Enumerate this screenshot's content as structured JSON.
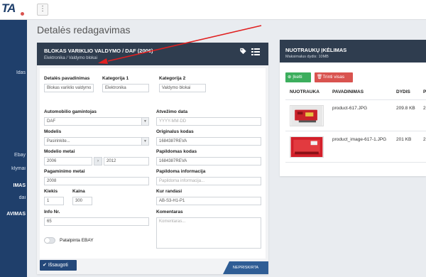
{
  "app": {
    "logo_text": "TA"
  },
  "sidebar": {
    "items": [
      {
        "label": "ldas"
      },
      {
        "label": "Ebay"
      },
      {
        "label": "klymai"
      },
      {
        "label": "IMAS"
      },
      {
        "label": "dai"
      },
      {
        "label": "AVIMAS"
      }
    ]
  },
  "page": {
    "title": "Detalės redagavimas"
  },
  "part_panel": {
    "title": "BLOKAS VARIKLIO VALDYMO / DAF (2006)",
    "subtitle": "Elektronika / Valdymo blokai",
    "fields": {
      "name": {
        "label": "Detalės pavadinimas",
        "value": "Blokas variklio valdymo"
      },
      "category1": {
        "label": "Kategorija 1",
        "value": "Elektronika"
      },
      "category2": {
        "label": "Kategorija 2",
        "value": "Valdymo blokai"
      },
      "manufacturer": {
        "label": "Automobilio gamintojas",
        "value": "DAF"
      },
      "arrival_date": {
        "label": "Atvežimo data",
        "placeholder": "YYYY-MM-DD"
      },
      "model": {
        "label": "Modelis",
        "value": "Pasirinkite..."
      },
      "original_code": {
        "label": "Originalus kodas",
        "value": "1684387REVA"
      },
      "model_years": {
        "label": "Modelio metai",
        "from": "2006",
        "to": "2012"
      },
      "extra_code": {
        "label": "Papildomas kodas",
        "value": "1684387REVA"
      },
      "production_year": {
        "label": "Pagaminimo metai",
        "value": "2008"
      },
      "extra_info": {
        "label": "Papildoma informacija",
        "placeholder": "Papildoma informacija..."
      },
      "quantity": {
        "label": "Kiekis",
        "value": "1"
      },
      "price": {
        "label": "Kaina",
        "value": "300"
      },
      "location": {
        "label": "Kur randasi",
        "value": "AB-S3-H1-P1"
      },
      "info_no": {
        "label": "Info Nr.",
        "value": "65"
      },
      "comments": {
        "label": "Komentaras",
        "placeholder": "Komentaras..."
      },
      "ebay": {
        "label": "Patalpinta EBAY"
      }
    },
    "save_label": "Išsaugoti",
    "status": "NEPRISKIRTA"
  },
  "photo_panel": {
    "title": "NUOTRAUKŲ ĮKĖLIMAS",
    "subtitle": "Maksimalus dydis: 10MB",
    "add_label": "Įkelti",
    "delete_label": "Trinti visas",
    "columns": [
      "NUOTRAUKA",
      "PAVADINIMAS",
      "DYDIS",
      "P"
    ],
    "rows": [
      {
        "name": "product-617.JPG",
        "size": "209.8 KB",
        "extra": "2"
      },
      {
        "name": "product_image-617-1.JPG",
        "size": "201 KB",
        "extra": "2"
      }
    ]
  },
  "colors": {
    "sidebar": "#1f3f6b",
    "panel_header": "#2f3d4f",
    "save_button": "#24487a",
    "add_button": "#3cae5d",
    "delete_button": "#d9534f",
    "annotation_arrow": "#e02020"
  }
}
